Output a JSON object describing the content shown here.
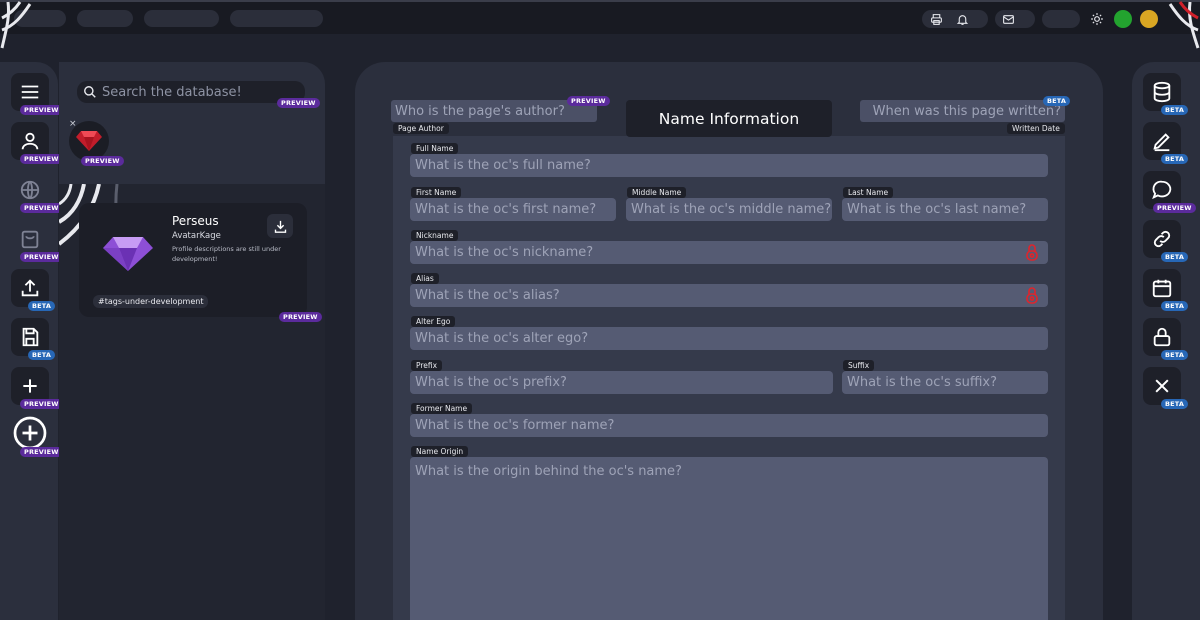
{
  "badges": {
    "preview": "PREVIEW",
    "beta": "BETA"
  },
  "colors": {
    "accent_purple": "#5b2b9c",
    "accent_blue": "#2767b6",
    "status_green": "#23a32f",
    "status_yellow": "#d9a623",
    "lock_red": "#e0242b"
  },
  "top_bar": {
    "icons": [
      "printer-icon",
      "bell-icon",
      "mail-icon",
      "sun-icon"
    ]
  },
  "left_rail": {
    "items": [
      {
        "icon": "menu-icon",
        "badge": "PREVIEW"
      },
      {
        "icon": "user-icon",
        "badge": "PREVIEW"
      },
      {
        "icon": "globe-icon",
        "badge": "PREVIEW"
      },
      {
        "icon": "bag-icon",
        "badge": "PREVIEW"
      },
      {
        "icon": "upload-icon",
        "badge": "BETA"
      },
      {
        "icon": "save-icon",
        "badge": "BETA"
      },
      {
        "icon": "plus-icon",
        "badge": "PREVIEW"
      },
      {
        "icon": "plus-circle-icon",
        "badge": "PREVIEW"
      }
    ]
  },
  "right_rail": {
    "items": [
      {
        "icon": "database-icon",
        "badge": "BETA"
      },
      {
        "icon": "pencil-icon",
        "badge": "BETA"
      },
      {
        "icon": "chat-icon",
        "badge": "PREVIEW"
      },
      {
        "icon": "link-icon",
        "badge": "BETA"
      },
      {
        "icon": "calendar-icon",
        "badge": "BETA"
      },
      {
        "icon": "lock-icon",
        "badge": "BETA"
      },
      {
        "icon": "close-icon",
        "badge": "BETA"
      }
    ]
  },
  "search": {
    "placeholder": "Search the database!",
    "badge": "PREVIEW"
  },
  "selected_avatar": {
    "badge": "PREVIEW",
    "close": "×"
  },
  "profile_card": {
    "name": "Perseus",
    "username": "AvatarKage",
    "description": "Profile descriptions are still under development!",
    "tag": "#tags-under-development",
    "badge": "PREVIEW"
  },
  "form": {
    "title": "Name Information",
    "page_author": {
      "label": "Page Author",
      "placeholder": "Who is the page's author?",
      "badge": "PREVIEW"
    },
    "written_date": {
      "label": "Written Date",
      "placeholder": "When was this page written?",
      "badge": "BETA"
    },
    "full_name": {
      "label": "Full Name",
      "placeholder": "What is the oc's full name?"
    },
    "first_name": {
      "label": "First Name",
      "placeholder": "What is the oc's first name?"
    },
    "middle_name": {
      "label": "Middle Name",
      "placeholder": "What is the oc's middle name?"
    },
    "last_name": {
      "label": "Last Name",
      "placeholder": "What is the oc's last name?"
    },
    "nickname": {
      "label": "Nickname",
      "placeholder": "What is the oc's nickname?"
    },
    "alias": {
      "label": "Alias",
      "placeholder": "What is the oc's alias?"
    },
    "alter_ego": {
      "label": "Alter Ego",
      "placeholder": "What is the oc's alter ego?"
    },
    "prefix": {
      "label": "Prefix",
      "placeholder": "What is the oc's prefix?"
    },
    "suffix": {
      "label": "Suffix",
      "placeholder": "What is the oc's suffix?"
    },
    "former_name": {
      "label": "Former Name",
      "placeholder": "What is the oc's former name?"
    },
    "name_origin": {
      "label": "Name Origin",
      "placeholder": "What is the origin behind the oc's name?"
    }
  }
}
